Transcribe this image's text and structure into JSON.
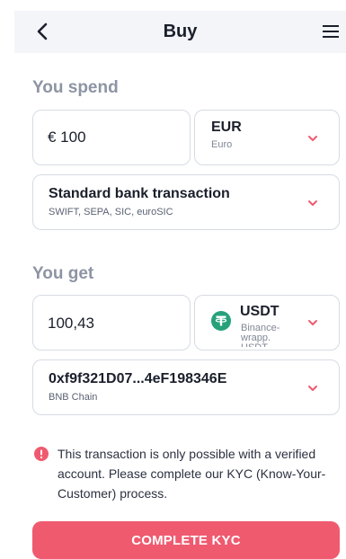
{
  "header": {
    "title": "Buy",
    "back_icon": "chevron-left-icon",
    "menu_icon": "hamburger-menu-icon"
  },
  "spend": {
    "label": "You spend",
    "amount": "€ 100",
    "currency_code": "EUR",
    "currency_name": "Euro",
    "payment_method_title": "Standard bank transaction",
    "payment_method_sub": "SWIFT, SEPA, SIC, euroSIC"
  },
  "get": {
    "label": "You get",
    "amount": "100,43",
    "currency_code": "USDT",
    "currency_name": "Binance-wrapp. USDT",
    "address": "0xf9f321D07...4eF198346E",
    "network": "BNB Chain"
  },
  "notice": {
    "text": "This transaction is only possible with a verified account. Please complete our KYC (Know-Your-Customer) process."
  },
  "cta": {
    "label": "COMPLETE KYC"
  },
  "colors": {
    "accent": "#ef5a6f",
    "tether": "#26a17b",
    "label_gray": "#8d94a3"
  }
}
